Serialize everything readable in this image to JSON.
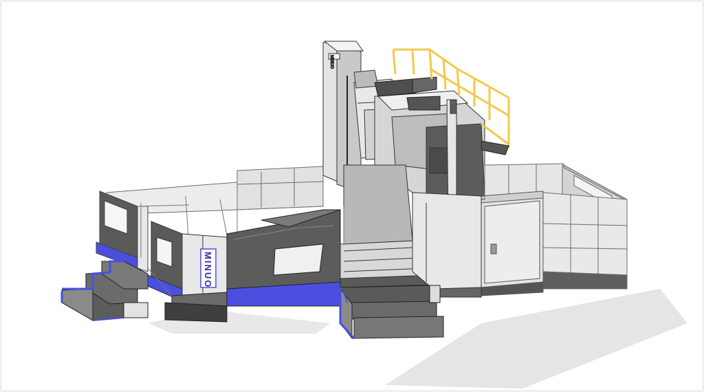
{
  "scene": {
    "brand_label": "MINUO",
    "column_label": "MINUO"
  },
  "colors": {
    "background": "#ffffff",
    "accent_blue": "#4a4fe0",
    "railing_yellow": "#f2c94c",
    "body_dark": "#5a5a5a",
    "panel_light": "#e6e6e6",
    "panel_mid": "#c8c8c8",
    "shadow": "#dcdcdc"
  },
  "icons": [
    "staircase-icon",
    "control-panel-icon",
    "railing-icon"
  ]
}
